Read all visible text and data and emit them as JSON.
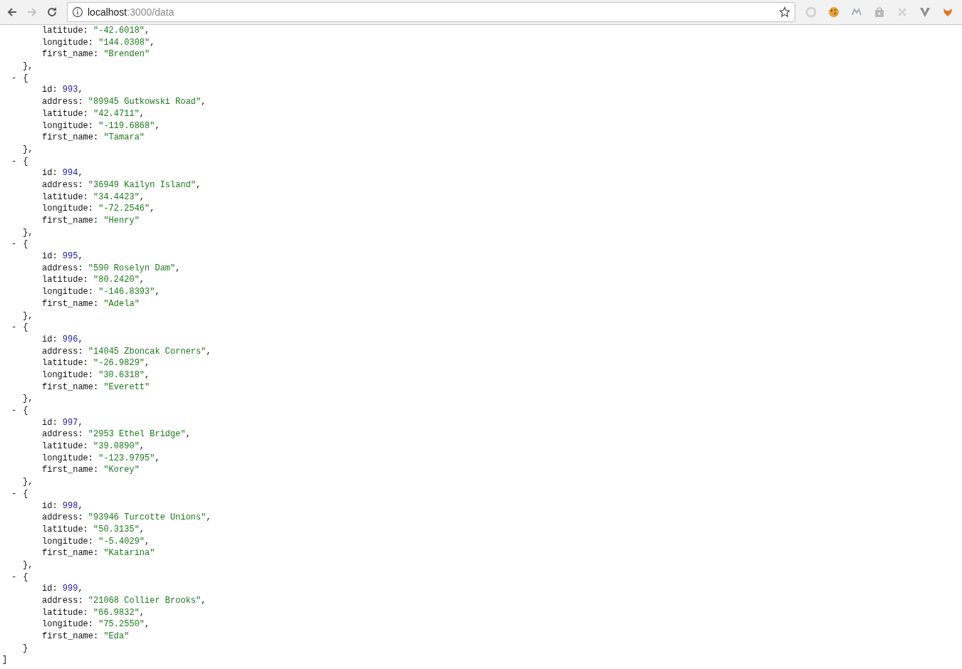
{
  "browser": {
    "back_enabled": true,
    "forward_enabled": false,
    "url_host": "localhost",
    "url_rest": ":3000/data"
  },
  "syntax": {
    "colon": ":",
    "comma": ",",
    "open": "{",
    "close": "}",
    "array_close": "]"
  },
  "records": [
    {
      "fields": [
        {
          "key": "latitude",
          "value": "\"-42.6018\"",
          "kind": "string"
        },
        {
          "key": "longitude",
          "value": "\"144.0308\"",
          "kind": "string"
        },
        {
          "key": "first_name",
          "value": "\"Brenden\"",
          "kind": "string"
        }
      ]
    },
    {
      "toggle": "-",
      "fields": [
        {
          "key": "id",
          "value": "993",
          "kind": "number"
        },
        {
          "key": "address",
          "value": "\"89945 Gutkowski Road\"",
          "kind": "string"
        },
        {
          "key": "latitude",
          "value": "\"42.4711\"",
          "kind": "string"
        },
        {
          "key": "longitude",
          "value": "\"-119.6868\"",
          "kind": "string"
        },
        {
          "key": "first_name",
          "value": "\"Tamara\"",
          "kind": "string"
        }
      ]
    },
    {
      "toggle": "-",
      "fields": [
        {
          "key": "id",
          "value": "994",
          "kind": "number"
        },
        {
          "key": "address",
          "value": "\"36949 Kailyn Island\"",
          "kind": "string"
        },
        {
          "key": "latitude",
          "value": "\"34.4423\"",
          "kind": "string"
        },
        {
          "key": "longitude",
          "value": "\"-72.2546\"",
          "kind": "string"
        },
        {
          "key": "first_name",
          "value": "\"Henry\"",
          "kind": "string"
        }
      ]
    },
    {
      "toggle": "-",
      "fields": [
        {
          "key": "id",
          "value": "995",
          "kind": "number"
        },
        {
          "key": "address",
          "value": "\"590 Roselyn Dam\"",
          "kind": "string"
        },
        {
          "key": "latitude",
          "value": "\"80.2420\"",
          "kind": "string"
        },
        {
          "key": "longitude",
          "value": "\"-146.8393\"",
          "kind": "string"
        },
        {
          "key": "first_name",
          "value": "\"Adela\"",
          "kind": "string"
        }
      ]
    },
    {
      "toggle": "-",
      "fields": [
        {
          "key": "id",
          "value": "996",
          "kind": "number"
        },
        {
          "key": "address",
          "value": "\"14045 Zboncak Corners\"",
          "kind": "string"
        },
        {
          "key": "latitude",
          "value": "\"-26.9829\"",
          "kind": "string"
        },
        {
          "key": "longitude",
          "value": "\"30.6318\"",
          "kind": "string"
        },
        {
          "key": "first_name",
          "value": "\"Everett\"",
          "kind": "string"
        }
      ]
    },
    {
      "toggle": "-",
      "fields": [
        {
          "key": "id",
          "value": "997",
          "kind": "number"
        },
        {
          "key": "address",
          "value": "\"2953 Ethel Bridge\"",
          "kind": "string"
        },
        {
          "key": "latitude",
          "value": "\"39.0890\"",
          "kind": "string"
        },
        {
          "key": "longitude",
          "value": "\"-123.9795\"",
          "kind": "string"
        },
        {
          "key": "first_name",
          "value": "\"Korey\"",
          "kind": "string"
        }
      ]
    },
    {
      "toggle": "-",
      "fields": [
        {
          "key": "id",
          "value": "998",
          "kind": "number"
        },
        {
          "key": "address",
          "value": "\"93946 Turcotte Unions\"",
          "kind": "string"
        },
        {
          "key": "latitude",
          "value": "\"50.3135\"",
          "kind": "string"
        },
        {
          "key": "longitude",
          "value": "\"-5.4029\"",
          "kind": "string"
        },
        {
          "key": "first_name",
          "value": "\"Katarina\"",
          "kind": "string"
        }
      ]
    },
    {
      "toggle": "-",
      "fields": [
        {
          "key": "id",
          "value": "999",
          "kind": "number"
        },
        {
          "key": "address",
          "value": "\"21068 Collier Brooks\"",
          "kind": "string"
        },
        {
          "key": "latitude",
          "value": "\"66.9832\"",
          "kind": "string"
        },
        {
          "key": "longitude",
          "value": "\"75.2550\"",
          "kind": "string"
        },
        {
          "key": "first_name",
          "value": "\"Eda\"",
          "kind": "string"
        }
      ]
    }
  ]
}
